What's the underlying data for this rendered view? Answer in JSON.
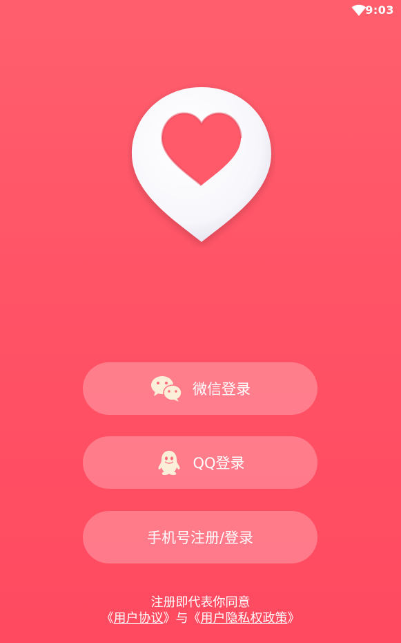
{
  "status_bar": {
    "time": "9:03",
    "wifi_icon": "wifi-icon"
  },
  "logo": {
    "icon": "heart-pin-logo"
  },
  "buttons": {
    "wechat": {
      "label": "微信登录",
      "icon": "wechat-icon"
    },
    "qq": {
      "label": "QQ登录",
      "icon": "qq-penguin-icon"
    },
    "phone": {
      "label": "手机号注册/登录"
    }
  },
  "agreement": {
    "line1": "注册即代表你同意",
    "open1": "《",
    "user_agreement": "用户协议",
    "close1": "》",
    "conjunction": "与",
    "open2": "《",
    "privacy_policy": "用户隐私权政策",
    "close2": "》"
  },
  "colors": {
    "background_top": "#ff5f6d",
    "background_bottom": "#ff4a60",
    "button_fill": "rgba(255,255,255,0.26)",
    "icon_cream": "#fbefd9"
  }
}
